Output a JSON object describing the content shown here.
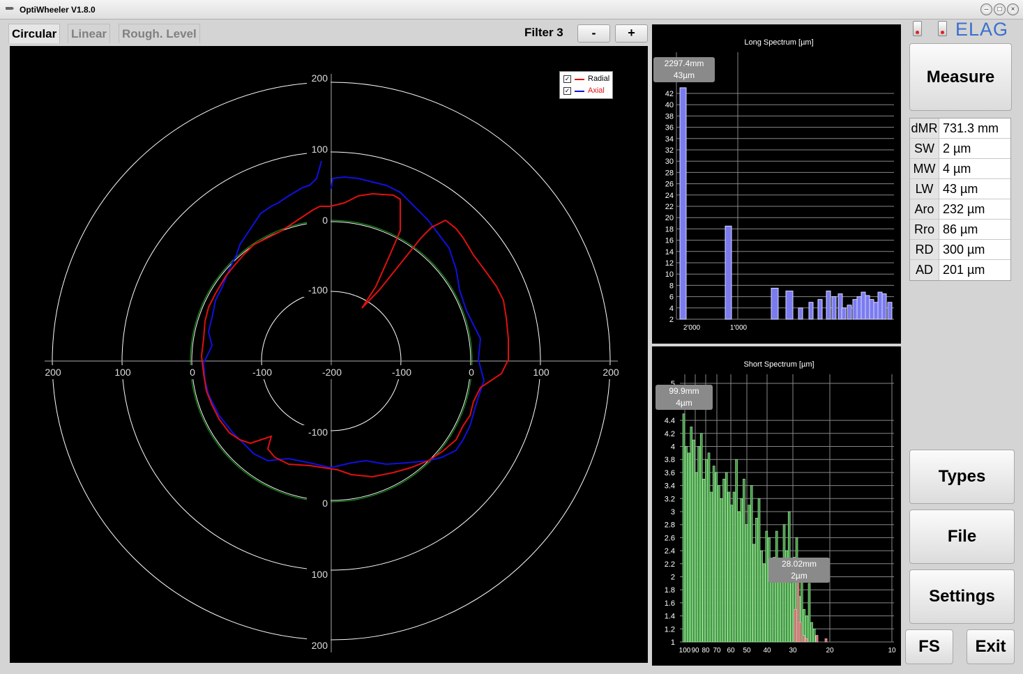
{
  "window": {
    "title": "OptiWheeler  V1.8.0"
  },
  "tabs": [
    {
      "label": "Circular"
    },
    {
      "label": "Linear"
    },
    {
      "label": "Rough. Level"
    }
  ],
  "filter": {
    "label": "Filter 3",
    "minus": "-",
    "plus": "+"
  },
  "polar": {
    "legend": [
      {
        "label": "Radial",
        "color": "#e01010"
      },
      {
        "label": "Axial",
        "color": "#1010e0"
      }
    ],
    "x_ticks": [
      "200",
      "100",
      "0",
      "-100",
      "-200",
      "-100",
      "0",
      "100",
      "200"
    ],
    "y_top_ticks": [
      "200",
      "100",
      "0",
      "-100"
    ],
    "y_bottom_ticks": [
      "-100",
      "0",
      "100",
      "200"
    ]
  },
  "long_spectrum": {
    "title": "Long Spectrum [µm]",
    "y_ticks": [
      "2",
      "4",
      "6",
      "8",
      "10",
      "12",
      "14",
      "16",
      "18",
      "20",
      "22",
      "24",
      "26",
      "28",
      "30",
      "32",
      "34",
      "36",
      "38",
      "40",
      "42"
    ],
    "x_ticks": [
      "2'000",
      "1'000"
    ],
    "tooltip": {
      "line1": "2297.4mm",
      "line2": "43µm"
    }
  },
  "short_spectrum": {
    "title": "Short Spectrum  [µm]",
    "y_ticks": [
      "1",
      "1.2",
      "1.4",
      "1.6",
      "1.8",
      "2",
      "2.2",
      "2.4",
      "2.6",
      "2.8",
      "3",
      "3.2",
      "3.4",
      "3.6",
      "3.8",
      "4",
      "4.2",
      "4.4",
      "5"
    ],
    "x_ticks": [
      "100",
      "90",
      "80",
      "70",
      "60",
      "50",
      "40",
      "30",
      "20",
      "10"
    ],
    "tooltip1": {
      "line1": "99.9mm",
      "line2": "4µm"
    },
    "tooltip2": {
      "line1": "28.02mm",
      "line2": "2µm"
    }
  },
  "brand": "ELAG",
  "buttons": {
    "measure": "Measure",
    "types": "Types",
    "file": "File",
    "settings": "Settings",
    "fs": "FS",
    "exit": "Exit"
  },
  "results": [
    {
      "key": "dMR",
      "value": "731.3 mm"
    },
    {
      "key": "SW",
      "value": "2 µm"
    },
    {
      "key": "MW",
      "value": "4 µm"
    },
    {
      "key": "LW",
      "value": "43 µm"
    },
    {
      "key": "Aro",
      "value": "232 µm"
    },
    {
      "key": "Rro",
      "value": "86 µm"
    },
    {
      "key": "RD",
      "value": "300 µm"
    },
    {
      "key": "AD",
      "value": "201 µm"
    }
  ]
}
